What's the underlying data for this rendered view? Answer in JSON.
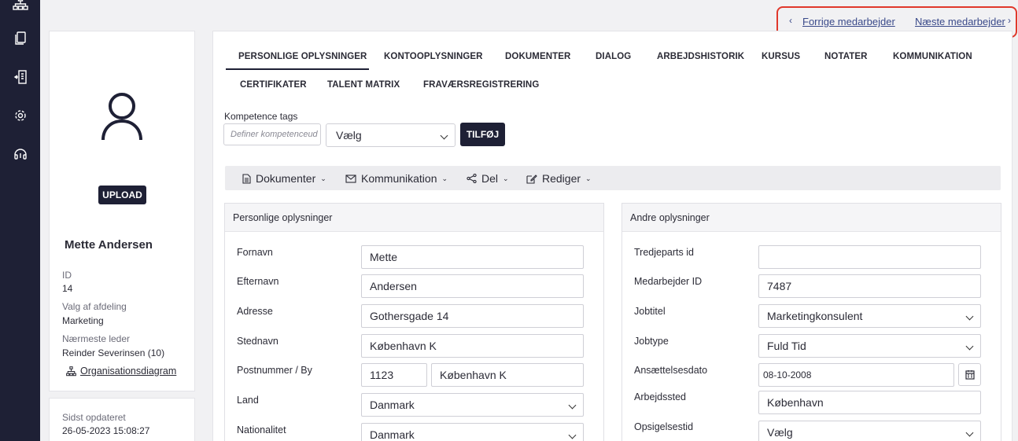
{
  "nav": {
    "prev_label": "Forrige medarbejder",
    "next_label": "Næste medarbejder"
  },
  "profile": {
    "upload_label": "UPLOAD",
    "name": "Mette Andersen",
    "id_label": "ID",
    "id_value": "14",
    "dept_label": "Valg af afdeling",
    "dept_value": "Marketing",
    "manager_label": "Nærmeste leder",
    "manager_value": "Reinder Severinsen (10)",
    "org_link": "Organisationsdiagram",
    "updated_label": "Sidst opdateret",
    "updated_value": "26-05-2023 15:08:27"
  },
  "tabs": [
    "PERSONLIGE OPLYSNINGER",
    "KONTOOPLYSNINGER",
    "DOKUMENTER",
    "DIALOG",
    "ARBEJDSHISTORIK",
    "KURSUS",
    "NOTATER",
    "KOMMUNIKATION",
    "CERTIFIKATER",
    "TALENT MATRIX",
    "FRAVÆRSREGISTRERING"
  ],
  "tags": {
    "label": "Kompetence tags",
    "placeholder": "Definer kompetenceud",
    "select_value": "Vælg",
    "add_label": "TILFØJ"
  },
  "toolbar": {
    "documents": "Dokumenter",
    "communication": "Kommunikation",
    "share": "Del",
    "edit": "Rediger"
  },
  "personal": {
    "title": "Personlige oplysninger",
    "fields": {
      "first_name_label": "Fornavn",
      "first_name": "Mette",
      "last_name_label": "Efternavn",
      "last_name": "Andersen",
      "address_label": "Adresse",
      "address": "Gothersgade 14",
      "city_label": "Stednavn",
      "city": "København K",
      "zip_label": "Postnummer / By",
      "zip": "1123",
      "zip_city": "København K",
      "country_label": "Land",
      "country": "Danmark",
      "nationality_label": "Nationalitet",
      "nationality": "Danmark"
    }
  },
  "other": {
    "title": "Andre oplysninger",
    "fields": {
      "third_party_label": "Tredjeparts id",
      "third_party": "",
      "employee_id_label": "Medarbejder ID",
      "employee_id": "7487",
      "job_title_label": "Jobtitel",
      "job_title": "Marketingkonsulent",
      "job_type_label": "Jobtype",
      "job_type": "Fuld Tid",
      "hire_date_label": "Ansættelsesdato",
      "hire_date": "08-10-2008",
      "workplace_label": "Arbejdssted",
      "workplace": "København",
      "notice_label": "Opsigelsestid",
      "notice": "Vælg"
    }
  }
}
